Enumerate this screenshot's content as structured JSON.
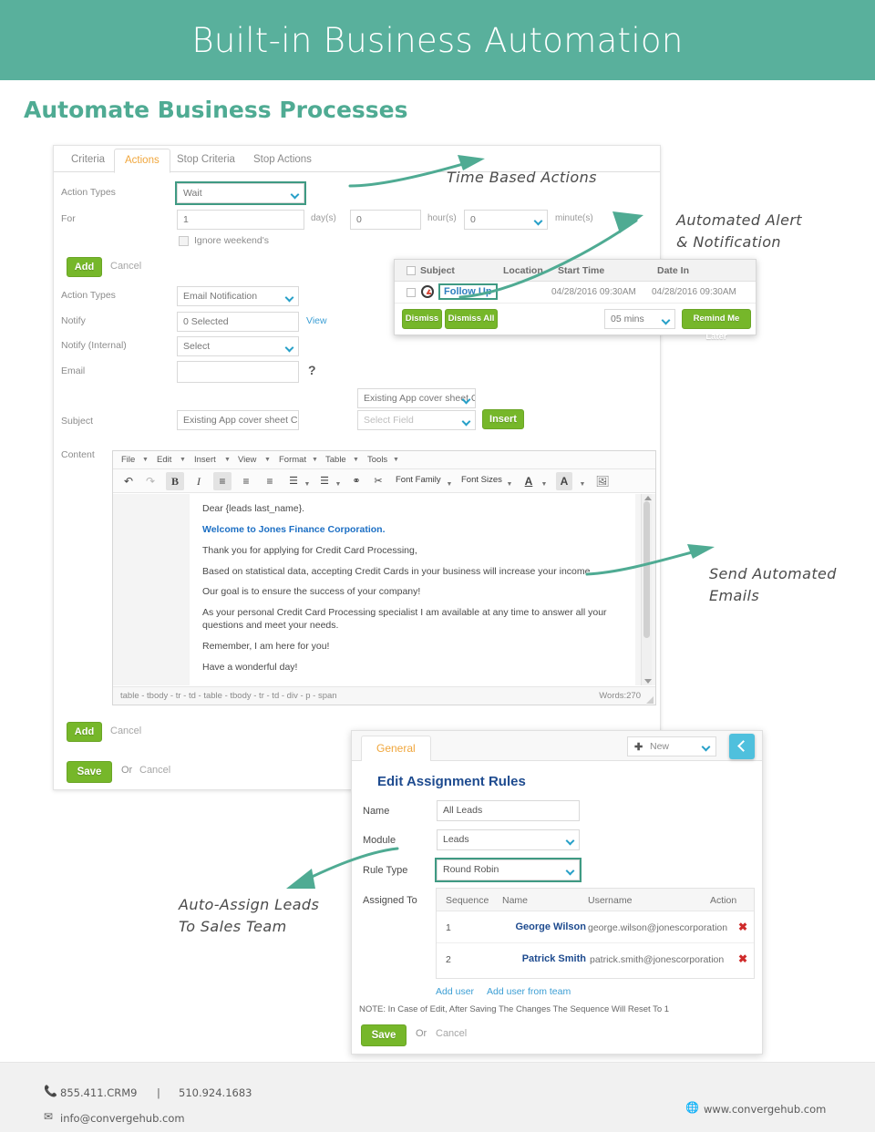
{
  "banner": {
    "title": "Built-in Business Automation"
  },
  "section": {
    "heading": "Automate Business Processes"
  },
  "workflow": {
    "tabs": [
      {
        "label": "Criteria",
        "active": false
      },
      {
        "label": "Actions",
        "active": true
      },
      {
        "label": "Stop Criteria",
        "active": false
      },
      {
        "label": "Stop Actions",
        "active": false
      }
    ],
    "wait_action": {
      "action_types_label": "Action Types",
      "action_types_value": "Wait",
      "for_label": "For",
      "days_value": "1",
      "days_unit": "day(s)",
      "hours_value": "0",
      "hours_unit": "hour(s)",
      "minutes_value": "0",
      "minutes_unit": "minute(s)",
      "ignore_weekends_label": "Ignore weekend's",
      "add_label": "Add",
      "cancel_label": "Cancel"
    },
    "email_action": {
      "action_types_label": "Action Types",
      "action_types_value": "Email Notification",
      "notify_label": "Notify",
      "notify_value": "0 Selected",
      "view_link": "View",
      "notify_internal_label": "Notify (Internal)",
      "notify_internal_value": "Select",
      "email_label": "Email",
      "email_value": "",
      "help_glyph": "?",
      "template_value": "Existing App cover sheet Cre",
      "subject_label": "Subject",
      "subject_value": "Existing App cover sheet Credit",
      "select_field_placeholder": "Select Field",
      "insert_label": "Insert",
      "content_label": "Content",
      "add_label": "Add",
      "cancel_label": "Cancel"
    },
    "footer_actions": {
      "save_label": "Save",
      "or_label": "Or",
      "cancel_label": "Cancel"
    }
  },
  "editor": {
    "menus": [
      "File",
      "Edit",
      "Insert",
      "View",
      "Format",
      "Table",
      "Tools"
    ],
    "toolbar": [
      {
        "name": "undo-icon",
        "glyph": "↶"
      },
      {
        "name": "redo-icon",
        "glyph": "↷"
      },
      {
        "name": "bold-icon",
        "glyph": "B"
      },
      {
        "name": "italic-icon",
        "glyph": "I"
      },
      {
        "name": "align-left-icon",
        "glyph": "≡"
      },
      {
        "name": "align-center-icon",
        "glyph": "≡"
      },
      {
        "name": "align-right-icon",
        "glyph": "≡"
      },
      {
        "name": "bullet-list-icon",
        "glyph": "☰"
      },
      {
        "name": "numbered-list-icon",
        "glyph": "☰"
      },
      {
        "name": "link-icon",
        "glyph": "⚭"
      },
      {
        "name": "unlink-icon",
        "glyph": "✂"
      },
      {
        "name": "text-color-icon",
        "glyph": "A"
      },
      {
        "name": "background-color-icon",
        "glyph": "A"
      },
      {
        "name": "image-icon",
        "glyph": "ὛC"
      }
    ],
    "font_family_label": "Font Family",
    "font_sizes_label": "Font Sizes",
    "body": [
      {
        "text": "Dear {leads last_name}.",
        "style": "normal"
      },
      {
        "text": "Welcome to Jones Finance Corporation.",
        "style": "blue"
      },
      {
        "text": "Thank you for applying for Credit Card Processing,",
        "style": "normal"
      },
      {
        "text": "Based on statistical data, accepting Credit Cards in your business will increase your income.",
        "style": "normal"
      },
      {
        "text": "Our goal is to ensure the success of your company!",
        "style": "normal"
      },
      {
        "text": "As your personal Credit Card Processing specialist I am available at any time to answer all your questions and meet your needs.",
        "style": "normal"
      },
      {
        "text": "Remember, I am here for you!",
        "style": "normal"
      },
      {
        "text": "Have a wonderful day!",
        "style": "normal"
      }
    ],
    "status_path": "table - tbody - tr - td - table - tbody - tr - td - div - p - span",
    "word_count": "Words:270"
  },
  "notification": {
    "columns": [
      "Subject",
      "Location",
      "Start Time",
      "Date In"
    ],
    "row": {
      "subject": "Follow Up",
      "location": "",
      "start_time": "04/28/2016 09:30AM",
      "date_in": "04/28/2016 09:30AM"
    },
    "dismiss_label": "Dismiss",
    "dismiss_all_label": "Dismiss All",
    "snooze_value": "05 mins",
    "remind_label": "Remind Me Later"
  },
  "assignment": {
    "tab_label": "General",
    "new_label": "New",
    "back_icon": "chevron-left-icon",
    "title": "Edit Assignment Rules",
    "name_label": "Name",
    "name_value": "All Leads",
    "module_label": "Module",
    "module_value": "Leads",
    "rule_type_label": "Rule Type",
    "rule_type_value": "Round Robin",
    "assigned_to_label": "Assigned To",
    "columns": [
      "Sequence",
      "Name",
      "Username",
      "Action"
    ],
    "rows": [
      {
        "sequence": "1",
        "name": "George Wilson",
        "username": "george.wilson@jonescorporation",
        "action": "✖"
      },
      {
        "sequence": "2",
        "name": "Patrick Smith",
        "username": "patrick.smith@jonescorporation",
        "action": "✖"
      }
    ],
    "add_user_label": "Add user",
    "add_user_team_label": "Add user from team",
    "note": "NOTE: In Case of Edit, After Saving The Changes The Sequence Will Reset To 1",
    "save_label": "Save",
    "or_label": "Or",
    "cancel_label": "Cancel"
  },
  "annotations": {
    "time_based": "Time Based Actions",
    "alert_line1": "Automated Alert",
    "alert_line2": "& Notification",
    "emails_line1": "Send Automated",
    "emails_line2": "Emails",
    "assign_line1": "Auto-Assign Leads",
    "assign_line2": "To Sales Team"
  },
  "footer": {
    "phone1": "855.411.CRM9",
    "separator": "|",
    "phone2": "510.924.1683",
    "email": "info@convergehub.com",
    "website": "www.convergehub.com"
  },
  "colors": {
    "teal": "#59b09c",
    "green": "#76b72a",
    "orange": "#f0a63c",
    "blue_link": "#3b9ed4",
    "heading_blue": "#1e4b8f",
    "cyan": "#4fc0dd",
    "red": "#e4322b"
  }
}
